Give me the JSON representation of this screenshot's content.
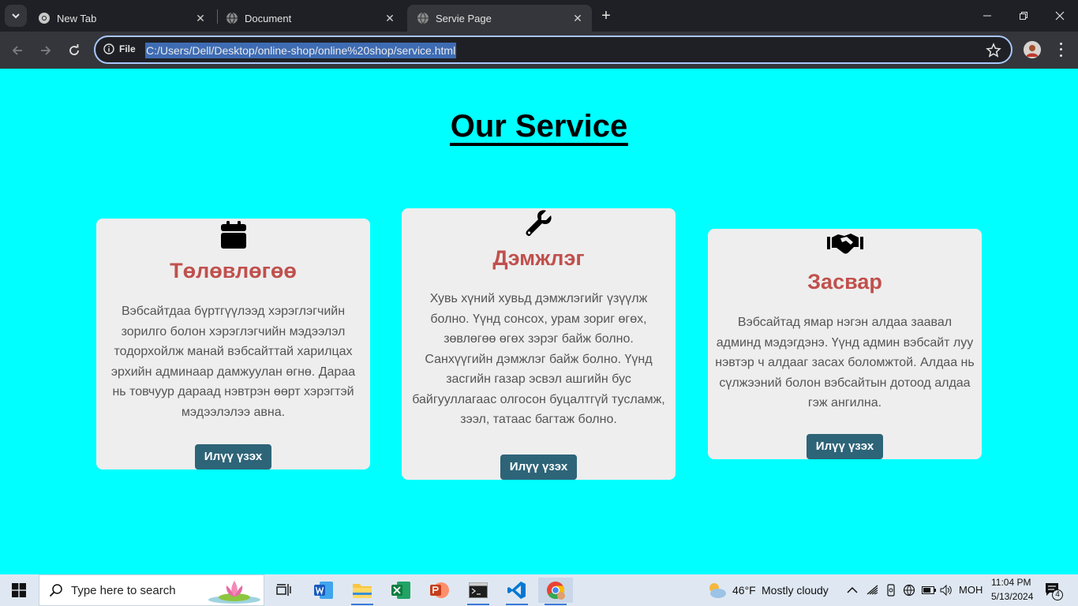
{
  "browser": {
    "tabs": [
      {
        "title": "New Tab",
        "active": false
      },
      {
        "title": "Document",
        "active": false
      },
      {
        "title": "Servie Page",
        "active": true
      }
    ],
    "omnibox": {
      "scheme_label": "File",
      "url": "C:/Users/Dell/Desktop/online-shop/online%20shop/service.html"
    }
  },
  "page": {
    "heading": "Our Service",
    "cards": [
      {
        "icon": "calendar-icon",
        "title": "Төлөвлөгөө",
        "text": "Вэбсайтдаа бүртгүүлээд хэрэглэгчийн зорилго болон хэрэглэгчийн мэдээлэл тодорхойлж манай вэбсайттай харилцах эрхийн админаар дамжуулан өгнө. Дараа нь товчуур дараад нэвтрэн өөрт хэрэгтэй мэдээлэлээ авна.",
        "button": "Илүү үзэх"
      },
      {
        "icon": "wrench-icon",
        "title": "Дэмжлэг",
        "text": "Хувь хүний хувьд дэмжлэгийг үзүүлж болно. Үүнд сонсох, урам зориг өгөх, зөвлөгөө өгөх зэрэг байж болно. Санхүүгийн дэмжлэг байж болно. Үүнд засгийн газар эсвэл ашгийн бус байгууллагаас олгосон буцалтгүй тусламж, зээл, татаас багтаж болно.",
        "button": "Илүү үзэх"
      },
      {
        "icon": "handshake-icon",
        "title": "Засвар",
        "text": "Вэбсайтад ямар нэгэн алдаа заавал админд мэдэгдэнэ. Үүнд админ вэбсайт луу нэвтэр ч алдааг засах боломжтой. Алдаа нь сүлжээний болон вэбсайтын дотоод алдаа гэж ангилна.",
        "button": "Илүү үзэх"
      }
    ],
    "colors": {
      "background": "#00ffff",
      "card": "#eeeeee",
      "card_title": "#c0504d",
      "button": "#2e6478"
    }
  },
  "taskbar": {
    "search_placeholder": "Type here to search",
    "weather": {
      "temp": "46°F",
      "condition": "Mostly cloudy"
    },
    "language": "МОН",
    "time": "11:04 PM",
    "date": "5/13/2024",
    "notifications": "4"
  }
}
